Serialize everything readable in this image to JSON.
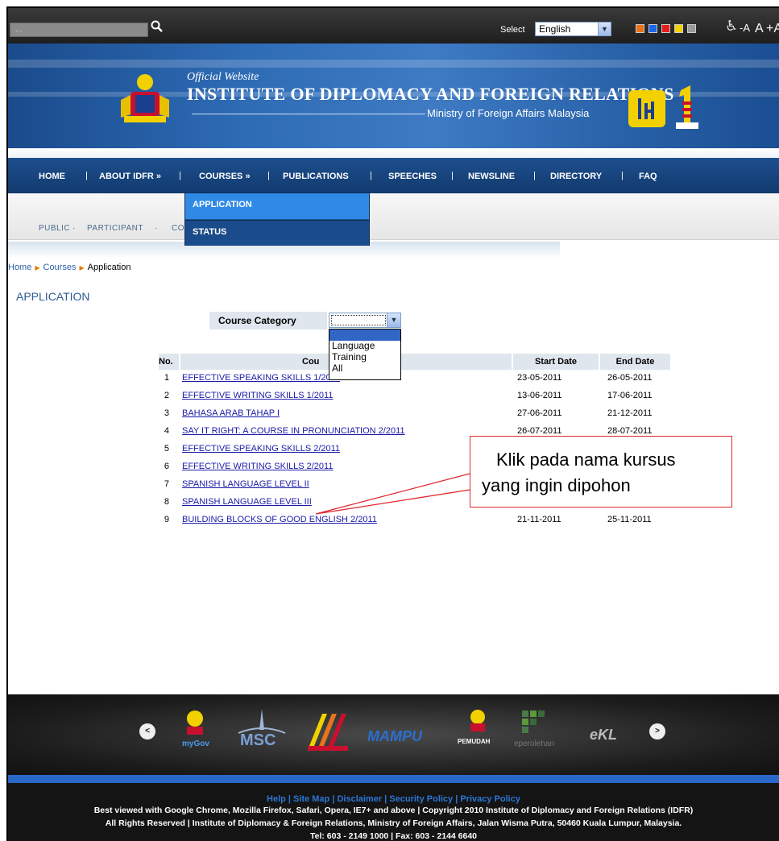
{
  "topbar": {
    "search_placeholder": "...",
    "select_label": "Select",
    "language_value": "English",
    "theme_colors": [
      "#e8731a",
      "#1e66e8",
      "#e81e1e",
      "#f2d200",
      "#9a9a9a"
    ],
    "font_small": "-A",
    "font_normal": "A",
    "font_large": "+A"
  },
  "banner": {
    "official": "Official Website",
    "title": "INSTITUTE OF DIPLOMACY AND FOREIGN RELATIONS",
    "ministry": "Ministry of Foreign Affairs Malaysia"
  },
  "nav": {
    "home": "HOME",
    "about": "ABOUT IDFR »",
    "courses": "COURSES »",
    "publications": "PUBLICATIONS",
    "speeches": "SPEECHES",
    "newsline": "NEWSLINE",
    "directory": "DIRECTORY",
    "faq": "FAQ",
    "sep": "|"
  },
  "courses_menu": {
    "application": "APPLICATION",
    "status": "STATUS"
  },
  "subnav": {
    "public": "PUBLIC",
    "participant": "PARTICIPANT",
    "partial": "CO",
    "dot": "·"
  },
  "breadcrumb": {
    "home": "Home",
    "courses": "Courses",
    "current": "Application"
  },
  "page_title": "APPLICATION",
  "filter": {
    "label": "Course Category",
    "options": [
      "",
      "Language",
      "Training",
      "All"
    ]
  },
  "table": {
    "headers": {
      "no": "No.",
      "course": "Cou",
      "start": "Start Date",
      "end": "End Date"
    },
    "rows": [
      {
        "no": "1",
        "course": "EFFECTIVE SPEAKING SKILLS 1/2011",
        "start": "23-05-2011",
        "end": "26-05-2011"
      },
      {
        "no": "2",
        "course": "EFFECTIVE WRITING SKILLS 1/2011",
        "start": "13-06-2011",
        "end": "17-06-2011"
      },
      {
        "no": "3",
        "course": "BAHASA ARAB TAHAP I",
        "start": "27-06-2011",
        "end": "21-12-2011"
      },
      {
        "no": "4",
        "course": "SAY IT RIGHT: A COURSE IN PRONUNCIATION 2/2011",
        "start": "26-07-2011",
        "end": "28-07-2011"
      },
      {
        "no": "5",
        "course": "EFFECTIVE SPEAKING SKILLS 2/2011",
        "start": "",
        "end": ""
      },
      {
        "no": "6",
        "course": "EFFECTIVE WRITING SKILLS 2/2011",
        "start": "",
        "end": ""
      },
      {
        "no": "7",
        "course": "SPANISH LANGUAGE LEVEL II",
        "start": "",
        "end": ""
      },
      {
        "no": "8",
        "course": "SPANISH LANGUAGE LEVEL III",
        "start": "",
        "end": ""
      },
      {
        "no": "9",
        "course": "BUILDING BLOCKS OF GOOD ENGLISH 2/2011",
        "start": "21-11-2011",
        "end": "25-11-2011"
      }
    ]
  },
  "callout": {
    "line1": "Klik pada nama kursus",
    "line2": "yang ingin dipohon"
  },
  "logos": {
    "prev": "<",
    "next": ">",
    "mygov": "myGov",
    "msc": "MSC",
    "mampu": "MAMPU",
    "pemudah": "PEMUDAH",
    "eperolehan": "eperolehan",
    "ekl": "eKL"
  },
  "footer": {
    "links": "Help | Site Map | Disclaimer | Security Policy | Privacy Policy",
    "line1": "Best viewed with Google Chrome, Mozilla Firefox, Safari, Opera, IE7+ and above | Copyright 2010   Institute of Diplomacy and Foreign Relations (IDFR)",
    "line2": "All Rights Reserved | Institute of Diplomacy & Foreign Relations, Ministry of Foreign Affairs, Jalan Wisma Putra, 50460 Kuala Lumpur, Malaysia.",
    "line3": "Tel: 603 - 2149 1000 | Fax: 603 - 2144 6640"
  }
}
